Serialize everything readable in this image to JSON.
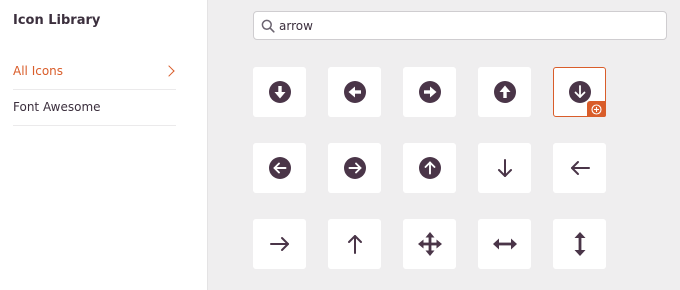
{
  "sidebar": {
    "title": "Icon Library",
    "items": [
      {
        "label": "All Icons",
        "active": true
      },
      {
        "label": "Font Awesome",
        "active": false
      }
    ]
  },
  "search": {
    "value": "arrow",
    "icon": "search-icon"
  },
  "icons": [
    {
      "name": "arrow-circle-down",
      "selected": false
    },
    {
      "name": "arrow-circle-left",
      "selected": false
    },
    {
      "name": "arrow-circle-right",
      "selected": false
    },
    {
      "name": "arrow-circle-up",
      "selected": true,
      "_note": "placeholder"
    },
    {
      "name": "arrow-circle-down-selected",
      "selected": true
    }
  ],
  "grid": [
    [
      "arrow-circle-down",
      "arrow-circle-left",
      "arrow-circle-right",
      "arrow-circle-up",
      "arrow-circle-down"
    ],
    [
      "arrow-alt-circle-left",
      "arrow-alt-circle-right",
      "arrow-alt-circle-up",
      "arrow-down",
      "arrow-left"
    ],
    [
      "arrow-right",
      "arrow-up",
      "arrows-alt",
      "arrows-alt-h",
      "arrows-alt-v"
    ]
  ],
  "selected_icon": "arrow-circle-down",
  "colors": {
    "accent": "#d95d2a",
    "icon": "#4a3548",
    "text": "#3b2f3d"
  }
}
